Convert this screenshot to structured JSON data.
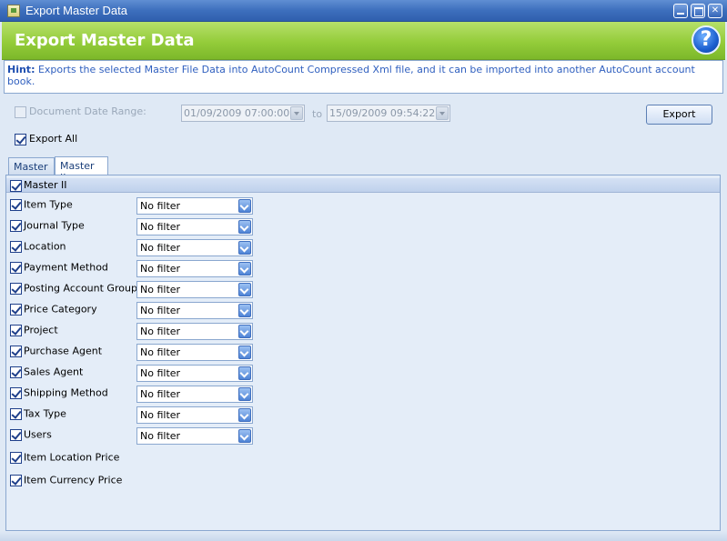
{
  "window": {
    "title": "Export Master Data",
    "controls": {
      "minimize": "",
      "maximize": "",
      "close": "✕"
    }
  },
  "banner": {
    "title": "Export Master Data",
    "help_label": "?"
  },
  "hint": {
    "label": "Hint:",
    "text": "Exports the selected Master File Data into AutoCount Compressed Xml file, and it can be imported into another AutoCount account book."
  },
  "date_range": {
    "label": "Document Date Range:",
    "checked": false,
    "enabled": false,
    "from": "01/09/2009 07:00:00",
    "to_label": "to",
    "to": "15/09/2009 09:54:22"
  },
  "export_button": "Export",
  "export_all": {
    "label": "Export All",
    "checked": true
  },
  "tabs": [
    {
      "label": "Master I",
      "active": false
    },
    {
      "label": "Master II",
      "active": true
    }
  ],
  "group": {
    "label": "Master II",
    "checked": true
  },
  "filter_rows": [
    {
      "label": "Item Type",
      "checked": true,
      "filter": "No filter"
    },
    {
      "label": "Journal Type",
      "checked": true,
      "filter": "No filter"
    },
    {
      "label": "Location",
      "checked": true,
      "filter": "No filter"
    },
    {
      "label": "Payment Method",
      "checked": true,
      "filter": "No filter"
    },
    {
      "label": "Posting Account Group",
      "checked": true,
      "filter": "No filter"
    },
    {
      "label": "Price Category",
      "checked": true,
      "filter": "No filter"
    },
    {
      "label": "Project",
      "checked": true,
      "filter": "No filter"
    },
    {
      "label": "Purchase Agent",
      "checked": true,
      "filter": "No filter"
    },
    {
      "label": "Sales Agent",
      "checked": true,
      "filter": "No filter"
    },
    {
      "label": "Shipping Method",
      "checked": true,
      "filter": "No filter"
    },
    {
      "label": "Tax Type",
      "checked": true,
      "filter": "No filter"
    },
    {
      "label": "Users",
      "checked": true,
      "filter": "No filter"
    }
  ],
  "plain_rows": [
    {
      "label": "Item Location Price",
      "checked": true
    },
    {
      "label": "Item Currency Price",
      "checked": true
    }
  ],
  "colors": {
    "title_bar": "#3d6fbd",
    "banner": "#94cc3a",
    "hint_text": "#2f5fbf",
    "panel_bg": "#e4edf8"
  }
}
